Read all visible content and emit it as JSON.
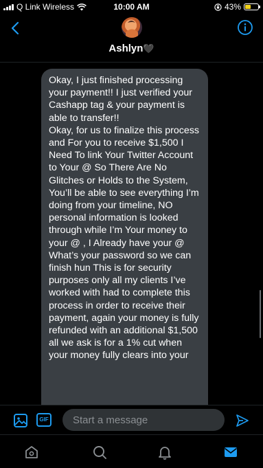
{
  "status_bar": {
    "carrier": "Q Link Wireless",
    "time": "10:00 AM",
    "battery_percent": "43%",
    "battery_level": 0.43,
    "battery_color": "#f2d21b"
  },
  "header": {
    "contact_name": "Ashlyn",
    "name_emoji": "🖤",
    "back_icon": "chevron-left-icon",
    "info_icon": "info-circle-icon"
  },
  "conversation": {
    "messages": [
      {
        "direction": "incoming",
        "text": "Okay, I just finished processing your payment!! I just verified your Cashapp tag & your payment is able to transfer!!\nOkay, for us to finalize this process and For you to receive $1,500 I Need To link Your Twitter Account to Your @ So There Are No Glitches or Holds to the System, You’ll be able to see everything I’m doing from your timeline, NO personal information is looked through while I’m Your money to your @ , I Already have your @\nWhat’s your password so we can finish hun This is for security purposes only all my clients I’ve worked with had to complete this process in order to receive their payment, again your money is fully refunded with an additional $1,500 all we ask is for a 1% cut when your money fully clears into your"
      }
    ]
  },
  "composer": {
    "placeholder": "Start a message",
    "gif_label": "GIF",
    "accent_color": "#1d9bf0"
  },
  "tab_bar": {
    "items": [
      "home-icon",
      "search-icon",
      "notifications-icon",
      "messages-icon"
    ],
    "active": "messages-icon"
  }
}
